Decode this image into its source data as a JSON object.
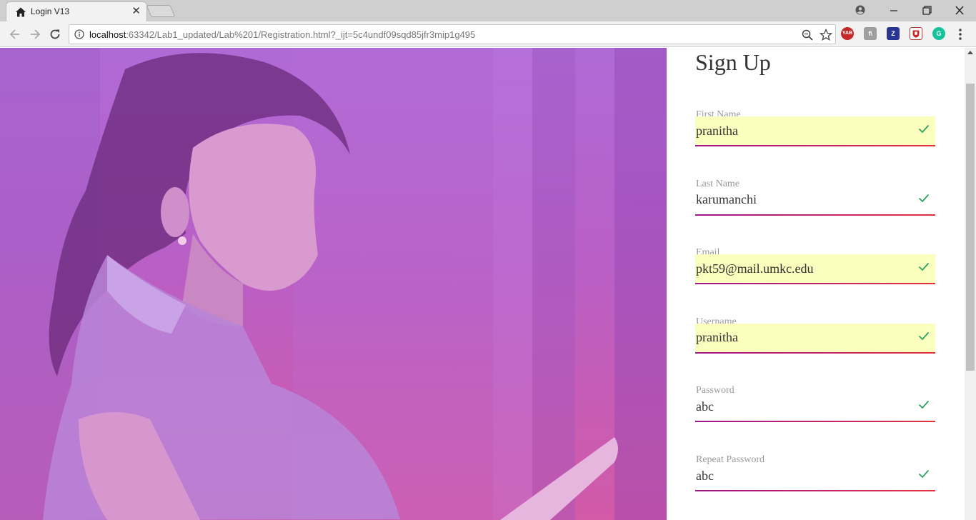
{
  "browser": {
    "tab_title": "Login V13",
    "url_host": "localhost",
    "url_rest": ":63342/Lab1_updated/Lab%201/Registration.html?_ijt=5c4undf09sqd85jfr3mip1g495",
    "extensions": [
      {
        "name": "yab-extension-icon",
        "label": "YAB",
        "color": "#c62828"
      },
      {
        "name": "f-extension-icon",
        "label": "f\\",
        "color": "#9e9e9e"
      },
      {
        "name": "z-extension-icon",
        "label": "Z",
        "color": "#283593"
      },
      {
        "name": "shield-extension-icon",
        "label": "",
        "color": "#ffffff"
      },
      {
        "name": "grammarly-icon",
        "label": "G",
        "color": "#15c39a"
      }
    ]
  },
  "form": {
    "title": "Sign Up",
    "fields": [
      {
        "label": "First Name",
        "value": "pranitha",
        "autofill": true
      },
      {
        "label": "Last Name",
        "value": "karumanchi",
        "autofill": false
      },
      {
        "label": "Email",
        "value": "pkt59@mail.umkc.edu",
        "autofill": true
      },
      {
        "label": "Username",
        "value": "pranitha",
        "autofill": true
      },
      {
        "label": "Password",
        "value": "abc",
        "autofill": false
      },
      {
        "label": "Repeat Password",
        "value": "abc",
        "autofill": false
      }
    ]
  },
  "colors": {
    "hero_top": "#b06ad6",
    "hero_bottom": "#d25aa7",
    "autofill": "#faffbd",
    "check": "#2ea063",
    "underline_start": "#a0158e",
    "underline_end": "#e4313d"
  }
}
